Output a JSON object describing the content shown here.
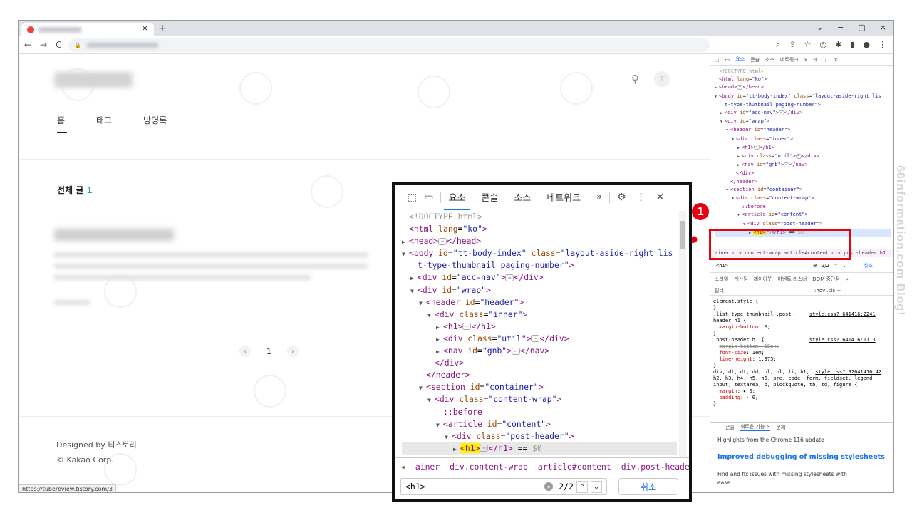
{
  "browser": {
    "tab_close": "×",
    "new_tab": "+",
    "window_controls": [
      "⌄",
      "−",
      "▢",
      "×"
    ],
    "nav": [
      "←",
      "→",
      "C"
    ],
    "lock": "🔒"
  },
  "blog": {
    "menu": [
      "홈",
      "태그",
      "방명록"
    ],
    "post_count_label": "전체 글",
    "post_count_value": "1",
    "pager": {
      "prev": "‹",
      "page": "1",
      "next": "›"
    },
    "footer_designed": "Designed by 티스토리",
    "footer_copy": "© Kakao Corp.",
    "avatar_letter": "T",
    "status_url": "https://tubereview.tistory.com/3"
  },
  "devtools_small": {
    "tabs": [
      "요소",
      "콘솔",
      "소스",
      "네트워크",
      "»"
    ],
    "breadcrumb": "ainer  div.content-wrap  article#content  div.post-header  h1",
    "search_value": "<h1>",
    "search_count": "2/2",
    "search_cancel": "취소",
    "subtabs": [
      "스타일",
      "계산됨",
      "레이아웃",
      "이벤트 리스너",
      "DOM 중단점",
      "»"
    ],
    "filter_label": "필터",
    "filter_right": ":hov  .cls  +",
    "drawer_tabs": [
      "콘솔",
      "새로운 기능 ×",
      "문제"
    ],
    "drawer_title": "Highlights from the Chrome 116 update",
    "drawer_link": "Improved debugging of missing stylesheets",
    "drawer_text": "Find and fix issues with missing stylesheets with ease."
  },
  "zoom": {
    "tabs": [
      "요소",
      "콘솔",
      "소스",
      "네트워크",
      "»"
    ],
    "tree": [
      {
        "indent": 0,
        "tri": "",
        "html": "<span class='cm'>&lt;!DOCTYPE html&gt;</span>"
      },
      {
        "indent": 0,
        "tri": "",
        "html": "<span class='tg'>&lt;html</span> <span class='at'>lang</span>=<span class='av'>\"ko\"</span><span class='tg'>&gt;</span>"
      },
      {
        "indent": 0,
        "tri": "▶",
        "html": "<span class='tg'>&lt;head&gt;</span><span class='dots'>⋯</span><span class='tg'>&lt;/head&gt;</span>"
      },
      {
        "indent": 0,
        "tri": "▼",
        "html": "<span class='tg'>&lt;body</span> <span class='at'>id</span>=<span class='av'>\"tt-body-index\"</span> <span class='at'>class</span>=<span class='av'>\"layout-aside-right lis</span>"
      },
      {
        "indent": 1,
        "tri": "",
        "html": "<span class='av'>t-type-thumbnail paging-number\"</span><span class='tg'>&gt;</span>"
      },
      {
        "indent": 1,
        "tri": "▶",
        "html": "<span class='tg'>&lt;div</span> <span class='at'>id</span>=<span class='av'>\"acc-nav\"</span><span class='tg'>&gt;</span><span class='dots'>⋯</span><span class='tg'>&lt;/div&gt;</span>"
      },
      {
        "indent": 1,
        "tri": "▼",
        "html": "<span class='tg'>&lt;div</span> <span class='at'>id</span>=<span class='av'>\"wrap\"</span><span class='tg'>&gt;</span>"
      },
      {
        "indent": 2,
        "tri": "▼",
        "html": "<span class='tg'>&lt;header</span> <span class='at'>id</span>=<span class='av'>\"header\"</span><span class='tg'>&gt;</span>"
      },
      {
        "indent": 3,
        "tri": "▼",
        "html": "<span class='tg'>&lt;div</span> <span class='at'>class</span>=<span class='av'>\"inner\"</span><span class='tg'>&gt;</span>"
      },
      {
        "indent": 4,
        "tri": "▶",
        "html": "<span class='tg'>&lt;h1&gt;</span><span class='dots'>⋯</span><span class='tg'>&lt;/h1&gt;</span>"
      },
      {
        "indent": 4,
        "tri": "▶",
        "html": "<span class='tg'>&lt;div</span> <span class='at'>class</span>=<span class='av'>\"util\"</span><span class='tg'>&gt;</span><span class='dots'>⋯</span><span class='tg'>&lt;/div&gt;</span>"
      },
      {
        "indent": 4,
        "tri": "▶",
        "html": "<span class='tg'>&lt;nav</span> <span class='at'>id</span>=<span class='av'>\"gnb\"</span><span class='tg'>&gt;</span><span class='dots'>⋯</span><span class='tg'>&lt;/nav&gt;</span>"
      },
      {
        "indent": 3,
        "tri": "",
        "html": "<span class='tg'>&lt;/div&gt;</span>"
      },
      {
        "indent": 2,
        "tri": "",
        "html": "<span class='tg'>&lt;/header&gt;</span>"
      },
      {
        "indent": 2,
        "tri": "▼",
        "html": "<span class='tg'>&lt;section</span> <span class='at'>id</span>=<span class='av'>\"container\"</span><span class='tg'>&gt;</span>"
      },
      {
        "indent": 3,
        "tri": "▼",
        "html": "<span class='tg'>&lt;div</span> <span class='at'>class</span>=<span class='av'>\"content-wrap\"</span><span class='tg'>&gt;</span>"
      },
      {
        "indent": 4,
        "tri": "",
        "html": "<span class='tg'>::before</span>"
      },
      {
        "indent": 4,
        "tri": "▼",
        "html": "<span class='tg'>&lt;article</span> <span class='at'>id</span>=<span class='av'>\"content\"</span><span class='tg'>&gt;</span>"
      },
      {
        "indent": 5,
        "tri": "▼",
        "html": "<span class='tg'>&lt;div</span> <span class='at'>class</span>=<span class='av'>\"post-header\"</span><span class='tg'>&gt;</span>"
      },
      {
        "indent": 6,
        "tri": "▶",
        "html": "<span class='tg hl'>&lt;h1&gt;</span><span class='dots'>⋯</span><span class='tg'>&lt;/h1&gt;</span> == <span class='cm'>$0</span>",
        "sel": true
      }
    ],
    "breadcrumb": [
      "◂",
      "ainer",
      "div.content-wrap",
      "article#content",
      "div.post-header",
      "h1",
      "▸"
    ],
    "search_value": "<h1>",
    "search_count": "2/2",
    "search_cancel": "취소"
  },
  "annotation": {
    "badge": "1"
  },
  "watermark": "60information.com Blog!",
  "colors": {
    "accent": "#1a73e8",
    "red": "#e60012",
    "tag": "#881280"
  }
}
